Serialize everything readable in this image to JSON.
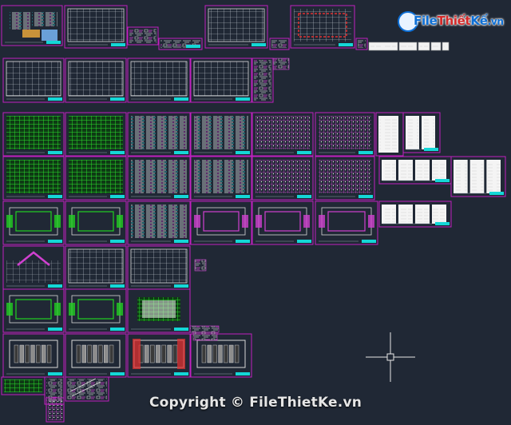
{
  "viewport": {
    "background_color": "#202835",
    "accent_colors": {
      "sheet_border": "#c020c0",
      "title_block": "#14d7d7",
      "green_layer": "#22d022",
      "magenta_layer": "#d040d0",
      "red_layer": "#e03030",
      "white_line": "#d8d8d8"
    }
  },
  "watermark": {
    "logo_word1": "File",
    "logo_word2": "Thiết",
    "logo_word3": "Kế",
    "logo_word4": ".vn",
    "copyright": "Copyright © FileThietKe.vn"
  },
  "icons": [
    "cad-crosshair-cursor-icon",
    "filethietke-logo-icon"
  ]
}
